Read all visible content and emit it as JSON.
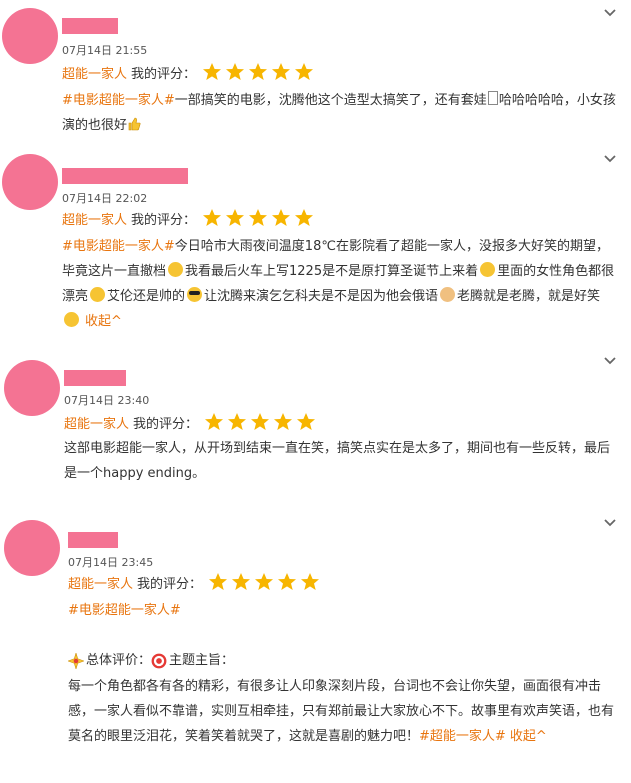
{
  "reviews": [
    {
      "date": "07月14日 21:55",
      "date_suffix": "",
      "movie": "超能一家人",
      "rating_label": "我的评分：",
      "stars": 5,
      "tag": "#电影超能一家人#",
      "text_1": "一部搞笑的电影，沈腾他这个造型太搞笑了，还有套娃",
      "text_2": "哈哈哈哈哈，小女孩演的也很好"
    },
    {
      "date": "07月14日 22:02",
      "date_suffix": "",
      "movie": "超能一家人",
      "rating_label": "我的评分：",
      "stars": 5,
      "tag": "#电影超能一家人#",
      "seg_1": "今日哈市大雨夜间温度18℃在影院看了超能一家人，没报多大好笑的期望，毕竟这片一直撤档",
      "seg_2": "我看最后火车上写1225是不是原打算圣诞节上来着",
      "seg_3": "里面的女性角色都很漂亮",
      "seg_4": "艾伦还是帅的",
      "seg_5": "让沈腾来演乞乞科夫是不是因为他会俄语",
      "seg_6": "老腾就是老腾，就是好笑",
      "collapse": "收起^"
    },
    {
      "date": "07月14日 23:40",
      "date_suffix": "",
      "movie": "超能一家人",
      "rating_label": "我的评分：",
      "stars": 5,
      "text": "这部电影超能一家人，从开场到结束一直在笑，搞笑点实在是太多了，期间也有一些反转，最后是一个happy ending。"
    },
    {
      "date": "07月14日 23:45",
      "date_suffix": "",
      "movie": "超能一家人",
      "rating_label": "我的评分：",
      "stars": 5,
      "tag": "#电影超能一家人#",
      "summary_label": "总体评价：",
      "theme_label": "主题主旨：",
      "text": "每一个角色都各有各的精彩，有很多让人印象深刻片段，台词也不会让你失望，画面很有冲击感，一家人看似不靠谱，实则互相牵挂，只有郑前最让大家放心不下。故事里有欢声笑语，也有莫名的眼里泛泪花，笑着笑着就哭了，这就是喜剧的魅力吧！",
      "tag_end": "#超能一家人#",
      "collapse": "收起^"
    }
  ],
  "colors": {
    "accent": "#e8750f",
    "avatar": "#f47393",
    "star": "#f7b500"
  },
  "icons": {
    "expand": "chevron-down-icon",
    "star": "star-icon"
  }
}
